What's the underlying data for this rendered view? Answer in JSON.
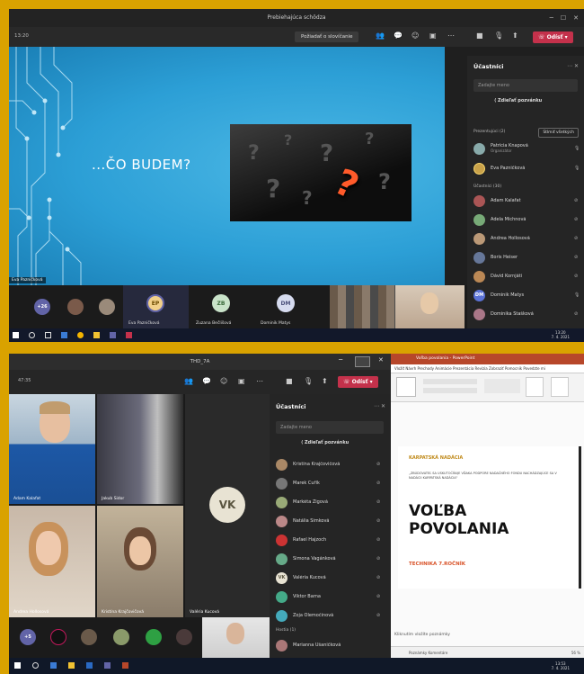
{
  "top": {
    "window_title": "Prebiehajúca schôdza",
    "time": "13:20",
    "raise_label": "Požiadať o slovíčanie",
    "leave_label": "Odísť",
    "slide_title": "...ČO BUDEM?",
    "presenter_label": "Eva Pazničková",
    "panel": {
      "title": "Účastníci",
      "search_placeholder": "Zadajte meno",
      "invite_label": "Zdieľať pozvánku",
      "presenters_header": "Prezentujúci (2)",
      "mute_all_label": "Stlmiť všetkých",
      "presenters": [
        {
          "name": "Patrícia Knapová",
          "sub": "Organizátor"
        },
        {
          "name": "Eva Pazničková",
          "sub": ""
        }
      ],
      "attendees_header": "Účastníci (30)",
      "attendees": [
        {
          "name": "Adam Kalafat",
          "initials": ""
        },
        {
          "name": "Adela Michnová",
          "initials": ""
        },
        {
          "name": "Andrea Hollosová",
          "initials": ""
        },
        {
          "name": "Boris Heiser",
          "initials": ""
        },
        {
          "name": "Dávid Kornjáti",
          "initials": ""
        },
        {
          "name": "Dominik Matys",
          "initials": "DM"
        },
        {
          "name": "Dominika Stašková",
          "initials": ""
        }
      ]
    },
    "strip": {
      "more_count": "+26",
      "tiles": [
        {
          "initials": "EP",
          "name": "Eva Pazničková"
        },
        {
          "initials": "ZB",
          "name": "Zuzana Bečlišová"
        },
        {
          "initials": "DM",
          "name": "Dominik Matys"
        }
      ]
    },
    "clock": {
      "time": "13:20",
      "date": "7. 4. 2021"
    }
  },
  "bottom": {
    "window_title": "THD_7A",
    "time": "47:35",
    "leave_label": "Odísť",
    "tiles": [
      {
        "name": "Adam Kalafat"
      },
      {
        "name": "Jakub Sidor"
      },
      {
        "name": "Andrea Hollosová"
      },
      {
        "name": "Kristína Krajčovičová"
      },
      {
        "name": "Valéria Kucová",
        "initials": "VK"
      }
    ],
    "panel": {
      "title": "Účastníci",
      "search_placeholder": "Zadajte meno",
      "invite_label": "Zdieľať pozvánku",
      "attendees": [
        {
          "name": "Kristína Krajčovičová",
          "initials": ""
        },
        {
          "name": "Marek Čuřík",
          "initials": ""
        },
        {
          "name": "Markéta Žigová",
          "initials": ""
        },
        {
          "name": "Natália Šimková",
          "initials": ""
        },
        {
          "name": "Rafael Hajzoch",
          "initials": ""
        },
        {
          "name": "Simona Vagánková",
          "initials": ""
        },
        {
          "name": "Valéria Kucová",
          "initials": "VK"
        },
        {
          "name": "Viktor Barna",
          "initials": ""
        },
        {
          "name": "Zoja Olemočinová",
          "initials": ""
        }
      ],
      "guests_header": "Hostia (1)",
      "guests": [
        {
          "name": "Marianna Ušaničková"
        }
      ]
    },
    "strip": {
      "more_count": "+5"
    },
    "ppt": {
      "title": "Voľba povolania - PowerPoint",
      "menu": "Vložiť  Návrh  Prechody  Animácie  Prezentácia  Revízia  Zobraziť  Pomocník  Povedzte mi",
      "brand": "KARPATSKÁ NADÁCIA",
      "intro": "„ZBÚDOVATEĽ SA USKUTOČŇUJE VĎAKA PODPORE NADAČNÉHO FONDU NACHÁDZAJÚCE SA V NADÁCII KARPATSKÁ NADÁCIA\"",
      "headline_1": "VOĽBA",
      "headline_2": "POVOLANIA",
      "subtitle": "TECHNIKA 7.ROČNÍK",
      "notes": "Kliknutím vložíte poznámky",
      "status": "Poznámky   Komentáre",
      "zoom": "56 %"
    },
    "clock": {
      "time": "13:53",
      "date": "7. 4. 2021"
    }
  },
  "colors": {
    "leave": "#c4314b",
    "orange_title": "#d9542a",
    "frame": "#d9a200"
  }
}
